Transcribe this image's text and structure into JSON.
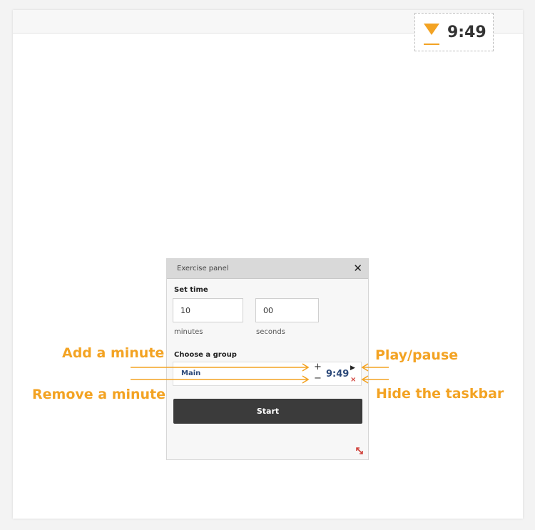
{
  "timer_widget": {
    "time": "9:49"
  },
  "panel": {
    "title": "Exercise panel",
    "set_time_label": "Set time",
    "minutes_value": "10",
    "minutes_label": "minutes",
    "seconds_value": "00",
    "seconds_label": "seconds",
    "choose_group_label": "Choose a group",
    "group": {
      "name": "Main",
      "time": "9:49",
      "plus": "+",
      "minus": "−",
      "play": "▶",
      "hide": "×"
    },
    "start_label": "Start",
    "close_symbol": "✕"
  },
  "annotations": {
    "add_minute": "Add a minute",
    "remove_minute": "Remove a minute",
    "play_pause": "Play/pause",
    "hide_taskbar": "Hide the taskbar"
  },
  "colors": {
    "accent_orange": "#f3a323",
    "dark_button": "#3b3b3b",
    "group_blue": "#2d4a7a",
    "hide_red": "#d0413a"
  }
}
